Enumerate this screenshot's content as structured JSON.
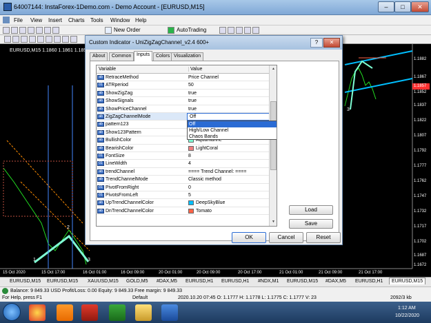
{
  "window": {
    "title": "64007144: InstaForex-1Demo.com - Demo Account - [EURUSD,M15]"
  },
  "menu": [
    "File",
    "View",
    "Insert",
    "Charts",
    "Tools",
    "Window",
    "Help"
  ],
  "toolbar": {
    "new_order": "New Order",
    "autotrading": "AutoTrading"
  },
  "chart": {
    "symbol_label": "EURUSD,M15  1.1860 1.1861 1.1856 1.1...",
    "prices": [
      "1.1882",
      "1.1867",
      "1.1857",
      "1.1852",
      "1.1837",
      "1.1822",
      "1.1807",
      "1.1792",
      "1.1777",
      "1.1762",
      "1.1747",
      "1.1732",
      "1.1717",
      "1.1702",
      "1.1687",
      "1.1672"
    ],
    "times": [
      "15 Oct 2020",
      "15 Oct 17:00",
      "16 Oct 01:00",
      "16 Oct 09:00",
      "20 Oct 01:00",
      "20 Oct 09:00",
      "20 Oct 17:00",
      "21 Oct 01:00",
      "21 Oct 09:00",
      "21 Oct 17:00"
    ],
    "wave_labels": [
      "2",
      "1",
      "3",
      "3"
    ]
  },
  "dialog": {
    "title": "Custom Indicator - UniZigZagChannel_v2.4 600+",
    "help": "?",
    "close": "✕",
    "tabs": [
      "About",
      "Common",
      "Inputs",
      "Colors",
      "Visualization"
    ],
    "grid": {
      "col_variable": "Variable",
      "col_value": "Value",
      "rows": [
        {
          "name": "RetraceMethod",
          "value": "Price Channel"
        },
        {
          "name": "ATRperiod",
          "value": "50"
        },
        {
          "name": "ShowZigZag",
          "value": "true"
        },
        {
          "name": "ShowSignals",
          "value": "true"
        },
        {
          "name": "ShowPriceChannel",
          "value": "true"
        },
        {
          "name": "ZigZagChannelMode",
          "value": "Off"
        },
        {
          "name": "pattern123",
          "value": ""
        },
        {
          "name": "Show123Pattern",
          "value": ""
        },
        {
          "name": "BullishColor",
          "value": "Aquamarine"
        },
        {
          "name": "BearishColor",
          "value": "LightCoral"
        },
        {
          "name": "FontSize",
          "value": "8"
        },
        {
          "name": "LineWidth",
          "value": "4"
        },
        {
          "name": "trendChannel",
          "value": "==== Trend Channel: ===="
        },
        {
          "name": "TrendChannelMode",
          "value": "Classic method"
        },
        {
          "name": "PivotFromRight",
          "value": "0"
        },
        {
          "name": "PivotsFromLeft",
          "value": "5"
        },
        {
          "name": "UpTrendChannelColor",
          "value": "DeepSkyBlue"
        },
        {
          "name": "DnTrendChannelColor",
          "value": "Tomato"
        }
      ]
    },
    "dropdown": {
      "selected": "Off",
      "options": [
        "Off",
        "High/Low Channel",
        "Chaos Bands"
      ]
    },
    "buttons": {
      "load": "Load",
      "save": "Save",
      "ok": "OK",
      "cancel": "Cancel",
      "reset": "Reset"
    },
    "swatch_colors": {
      "Aquamarine": "#7fffd4",
      "LightCoral": "#f08080",
      "DeepSkyBlue": "#00bfff",
      "Tomato": "#ff6347"
    }
  },
  "symbol_tabs": [
    "EURUSD,M15",
    "EURUSD,M15",
    "XAUUSD,M15",
    "GOLD,M5",
    "#DAX,M5",
    "EURUSD,H1",
    "EURUSD,H1",
    "#NDX,M1",
    "EURUSD,M15",
    "#DAX,M5",
    "EURUSD,H1",
    "EURUSD,M15"
  ],
  "status": {
    "balance": "Balance: 9 849.33 USD  Profit/Loss: 0.00  Equity: 9 849.33  Free margin: 9 849.33",
    "help": "For Help, press F1",
    "profile": "Default",
    "ohlc": "2020.10.20 07:45  O: 1.1777  H: 1.1778  L: 1.1775  C: 1.1777  V: 23",
    "traffic": "2092/3 kb"
  },
  "taskbar": {
    "time": "1:12 AM",
    "date": "10/22/2020"
  }
}
